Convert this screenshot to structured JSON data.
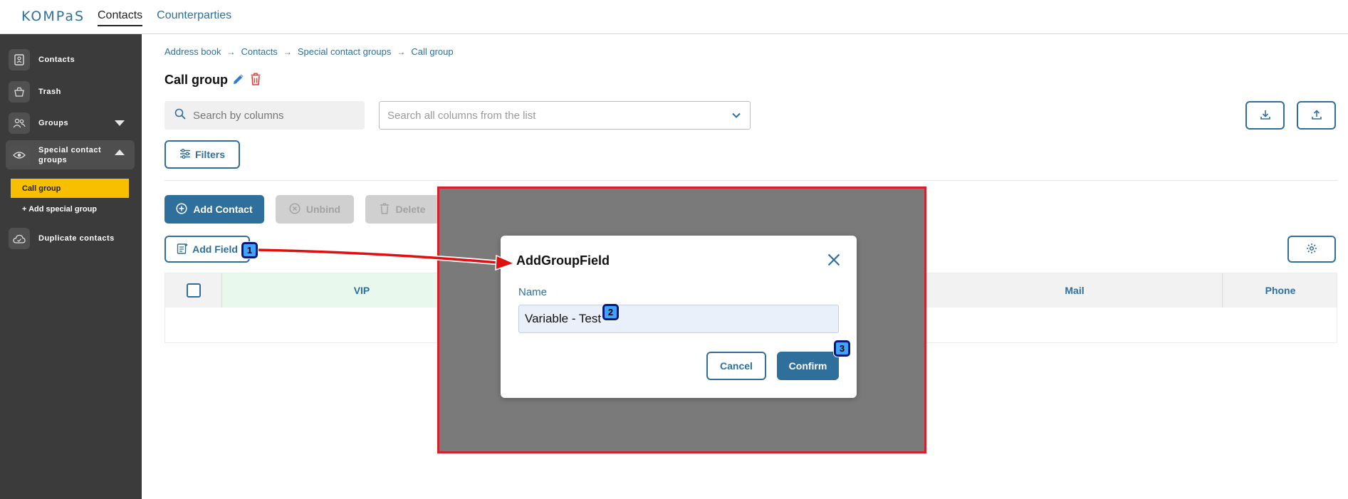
{
  "topbar": {
    "logo": "KOMPaS",
    "nav": [
      {
        "label": "Contacts",
        "active": true
      },
      {
        "label": "Counterparties",
        "active": false
      }
    ]
  },
  "sidebar": {
    "items": [
      {
        "label": "Contacts",
        "icon": "contacts-book-icon"
      },
      {
        "label": "Trash",
        "icon": "trash-basket-icon"
      },
      {
        "label": "Groups",
        "icon": "users-icon",
        "expanded": false
      },
      {
        "label": "Special contact groups",
        "icon": "eye-icon",
        "expanded": true
      },
      {
        "label": "Duplicate contacts",
        "icon": "cloud-icon"
      }
    ],
    "subitems": [
      {
        "label": "Call group",
        "active": true
      },
      {
        "label": "+ Add special group",
        "active": false
      }
    ]
  },
  "breadcrumb": [
    "Address book",
    "Contacts",
    "Special contact groups",
    "Call group"
  ],
  "page": {
    "title": "Call group"
  },
  "toolbar": {
    "search_placeholder": "Search by columns",
    "columns_select_placeholder": "Search all columns from the list",
    "filters_label": "Filters",
    "add_contact_label": "Add Contact",
    "unbind_label": "Unbind",
    "delete_label": "Delete",
    "add_field_label": "Add Field"
  },
  "table": {
    "columns": [
      "VIP",
      "Mail",
      "Phone"
    ]
  },
  "dialog": {
    "title": "AddGroupField",
    "name_label": "Name",
    "name_value": "Variable - Test",
    "cancel_label": "Cancel",
    "confirm_label": "Confirm"
  },
  "annotations": {
    "markers": [
      "1",
      "2",
      "3"
    ],
    "highlight_color": "#d3222e",
    "marker_color": "#3fa3ff"
  },
  "colors": {
    "accent": "#2f6f9b",
    "sidebar_bg": "#3b3b3b",
    "active_sub": "#f7bf00",
    "vip_header": "#e9f8ec"
  }
}
